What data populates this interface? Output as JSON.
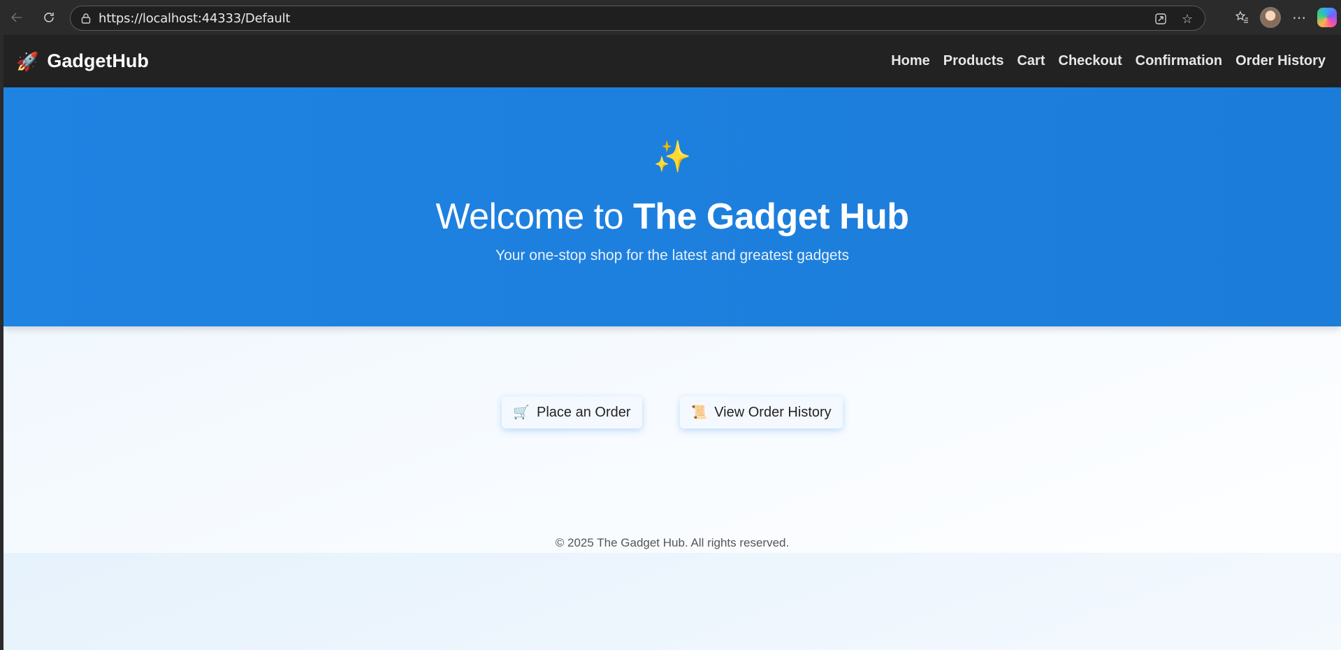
{
  "browser": {
    "url": "https://localhost:44333/Default",
    "icons": [
      "back-icon",
      "reload-icon",
      "lock-icon",
      "read-aloud-icon",
      "favorite-star-icon",
      "favorites-icon",
      "profile-avatar",
      "more-icon",
      "copilot-icon"
    ]
  },
  "navbar": {
    "brand_icon": "🚀",
    "brand_name": "GadgetHub",
    "links": [
      "Home",
      "Products",
      "Cart",
      "Checkout",
      "Confirmation",
      "Order History"
    ]
  },
  "hero": {
    "icon": "✨",
    "title_prefix": "Welcome to ",
    "title_bold": "The Gadget Hub",
    "subtitle": "Your one-stop shop for the latest and greatest gadgets"
  },
  "actions": {
    "place_order_icon": "🛒",
    "place_order_label": "Place an Order",
    "history_icon": "📜",
    "history_label": "View Order History"
  },
  "footer": {
    "text": "© 2025 The Gadget Hub. All rights reserved."
  },
  "colors": {
    "navbar_bg": "#222222",
    "hero_bg": "#1f83e2",
    "page_bg": "#eaf4fd"
  }
}
